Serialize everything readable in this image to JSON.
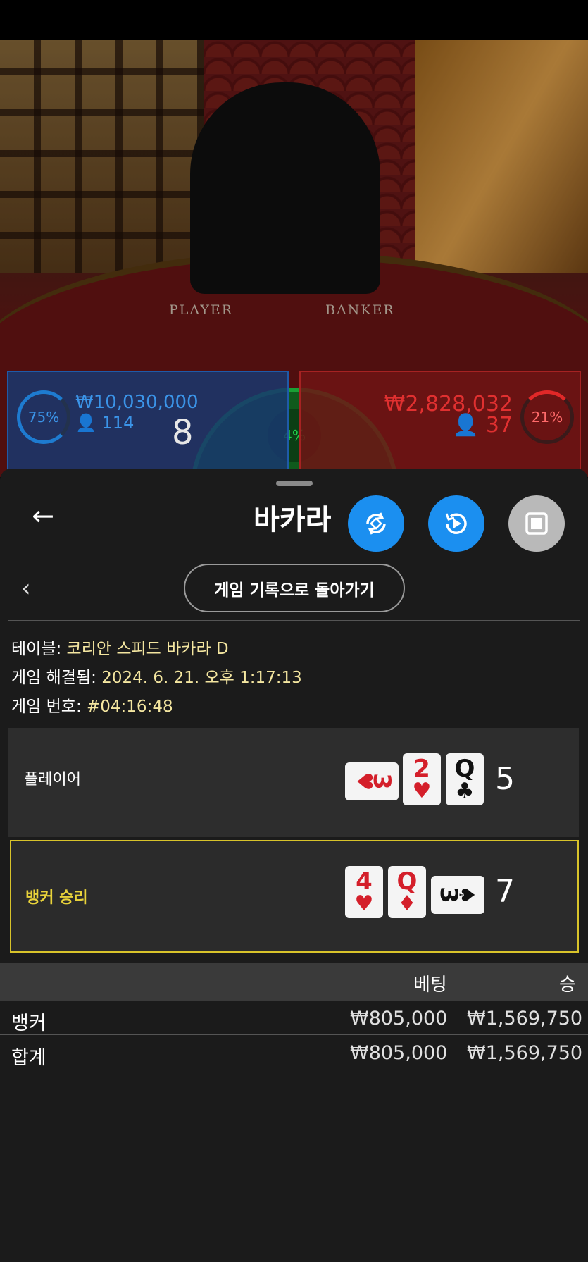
{
  "video": {
    "table_label_player": "PLAYER",
    "table_label_banker": "BANKER"
  },
  "player_panel": {
    "percent": "75%",
    "amount": "₩10,030,000",
    "count": "114",
    "score": "8"
  },
  "banker_panel": {
    "percent": "21%",
    "amount": "₩2,828,032",
    "count": "37"
  },
  "tie": {
    "percent": "4%"
  },
  "sheet": {
    "title": "바카라",
    "back_icon": "arrow-left-icon",
    "return_button": "게임 기록으로 돌아가기",
    "info": [
      {
        "label": "테이블:",
        "value": "코리안 스피드 바카라 D"
      },
      {
        "label": "게임 해결됨:",
        "value": "2024. 6. 21. 오후 1:17:13"
      },
      {
        "label": "게임 번호:",
        "value": "#04:16:48"
      }
    ],
    "player_row": {
      "label": "플레이어",
      "cards": [
        {
          "rank": "3",
          "suit": "♥",
          "orientation": "sideways"
        },
        {
          "rank": "2",
          "suit": "♥",
          "orientation": "upright"
        },
        {
          "rank": "Q",
          "suit": "♣",
          "orientation": "upright"
        }
      ],
      "score": "5"
    },
    "banker_row": {
      "label": "뱅커 승리",
      "cards": [
        {
          "rank": "4",
          "suit": "♥",
          "orientation": "upright"
        },
        {
          "rank": "Q",
          "suit": "♦",
          "orientation": "upright"
        },
        {
          "rank": "3",
          "suit": "♠",
          "orientation": "sideways"
        }
      ],
      "score": "7"
    },
    "table": {
      "headers": [
        "베팅",
        "승"
      ],
      "rows": [
        {
          "name": "뱅커",
          "bet": "₩805,000",
          "win": "₩1,569,750"
        },
        {
          "name": "합계",
          "bet": "₩805,000",
          "win": "₩1,569,750"
        }
      ]
    }
  },
  "colors": {
    "accent_blue": "#1b8ff0",
    "banker_red": "#e03030",
    "win_highlight": "#d8c32a",
    "tie_green": "#22d14a"
  }
}
